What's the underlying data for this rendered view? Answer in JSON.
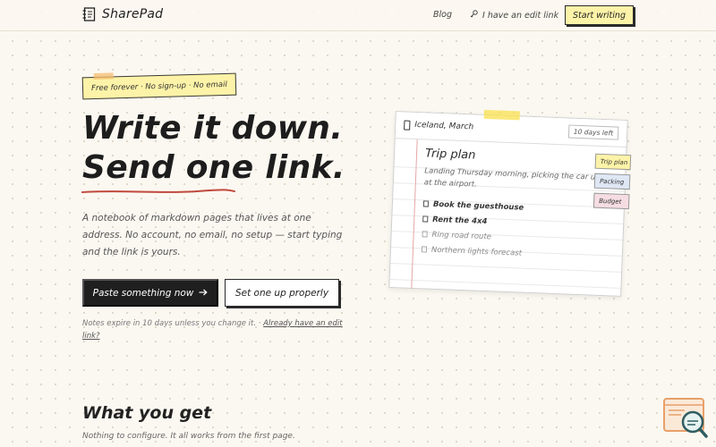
{
  "nav": {
    "brand": "SharePad",
    "links": {
      "blog": "Blog",
      "edit_link": "I have an edit link"
    },
    "cta": "Start writing"
  },
  "hero": {
    "tag": "Free forever · No sign-up · No email",
    "title_line1": "Write it down.",
    "title_line2": "Send one link.",
    "lead": "A notebook of markdown pages that lives at one address. No account, no email, no setup — start typing and the link is yours.",
    "primary_button": "Paste something now",
    "secondary_button": "Set one up properly",
    "note_text": "Notes expire in 10 days unless you change it. · ",
    "note_link": "Already have an edit link?"
  },
  "notebook": {
    "title": "Iceland, March",
    "expiry": "10 days left",
    "page_title": "Trip plan",
    "description": "Landing Thursday morning, picking the car up at the airport.",
    "todos": [
      {
        "label": "Book the guesthouse",
        "done": true
      },
      {
        "label": "Rent the 4x4",
        "done": true
      },
      {
        "label": "Ring road route",
        "done": false
      },
      {
        "label": "Northern lights forecast",
        "done": false
      }
    ],
    "tabs": [
      "Trip plan",
      "Packing",
      "Budget"
    ]
  },
  "features": {
    "title": "What you get",
    "subtitle": "Nothing to configure. It all works from the first page."
  },
  "colors": {
    "accent_yellow": "#fdf3a8",
    "ink": "#1f1f1f",
    "underline_red": "#c0483c",
    "background": "#fbf8f1"
  },
  "icons": {
    "brand": "notebook-icon",
    "edit": "key-icon",
    "arrow": "arrow-right-icon",
    "lock": "lock-icon",
    "corner": "magnifier-logo-icon"
  }
}
